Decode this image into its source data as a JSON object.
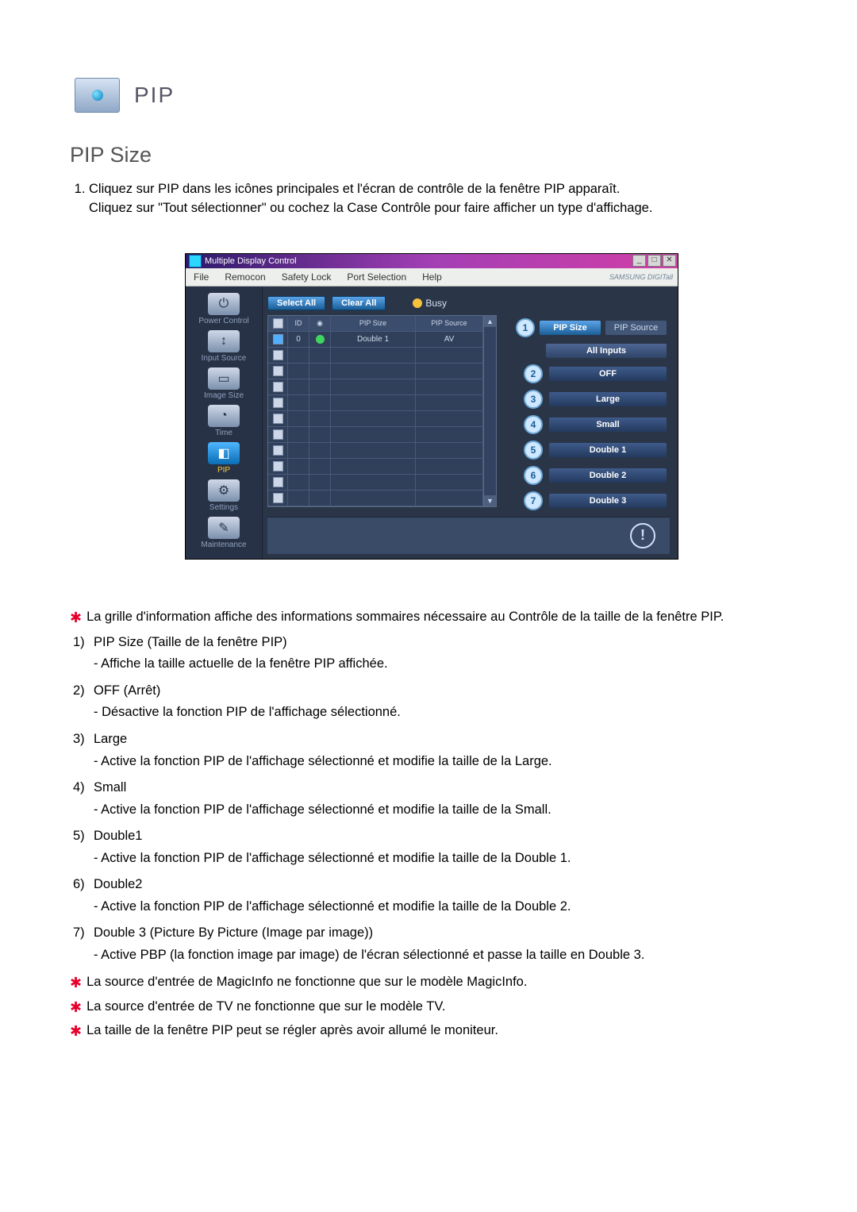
{
  "header": {
    "pip_label": "PIP",
    "pip_size_label": "PIP Size"
  },
  "intro": {
    "item1": "Cliquez sur PIP dans les icônes principales et l'écran de contrôle de la fenêtre PIP apparaît.",
    "item1b": "Cliquez sur \"Tout sélectionner\" ou cochez la Case Contrôle pour faire afficher un type d'affichage."
  },
  "shot": {
    "title": "Multiple Display Control",
    "menu": {
      "file": "File",
      "remocon": "Remocon",
      "safety": "Safety Lock",
      "port": "Port Selection",
      "help": "Help",
      "brand": "SAMSUNG DIGITall"
    },
    "buttons": {
      "select_all": "Select All",
      "clear_all": "Clear All",
      "busy": "Busy"
    },
    "sidebar": [
      {
        "label": "Power Control",
        "icon": "⏻"
      },
      {
        "label": "Input Source",
        "icon": "↕"
      },
      {
        "label": "Image Size",
        "icon": "▭"
      },
      {
        "label": "Time",
        "icon": "◔"
      },
      {
        "label": "PIP",
        "icon": "◧",
        "sel": true
      },
      {
        "label": "Settings",
        "icon": "⚙"
      },
      {
        "label": "Maintenance",
        "icon": "✎"
      }
    ],
    "grid": {
      "headers": {
        "chk": "☑",
        "id": "ID",
        "status": "",
        "size": "PIP Size",
        "source": "PIP Source"
      },
      "row": {
        "id": "0",
        "size": "Double 1",
        "source": "AV"
      }
    },
    "right": {
      "tab_size": "PIP Size",
      "tab_source": "PIP Source",
      "all_inputs": "All Inputs",
      "opts": [
        {
          "n": "2",
          "label": "OFF"
        },
        {
          "n": "3",
          "label": "Large"
        },
        {
          "n": "4",
          "label": "Small"
        },
        {
          "n": "5",
          "label": "Double 1"
        },
        {
          "n": "6",
          "label": "Double 2"
        },
        {
          "n": "7",
          "label": "Double 3"
        }
      ],
      "callout1": "1"
    }
  },
  "notes": {
    "star1": "La grille d'information affiche des informations sommaires nécessaire au Contrôle de la taille de la fenêtre PIP.",
    "items": [
      {
        "n": "1)",
        "t": "PIP Size (Taille de la fenêtre PIP)",
        "s": "- Affiche la taille actuelle de la fenêtre PIP affichée."
      },
      {
        "n": "2)",
        "t": "OFF (Arrêt)",
        "s": "- Désactive la fonction PIP de l'affichage sélectionné."
      },
      {
        "n": "3)",
        "t": "Large",
        "s": "- Active la fonction PIP de l'affichage sélectionné et modifie la taille de la Large."
      },
      {
        "n": "4)",
        "t": "Small",
        "s": "- Active la fonction PIP de l'affichage sélectionné et modifie la taille de la Small."
      },
      {
        "n": "5)",
        "t": "Double1",
        "s": "- Active la fonction PIP de l'affichage sélectionné et modifie la taille de la Double 1."
      },
      {
        "n": "6)",
        "t": "Double2",
        "s": "- Active la fonction PIP de l'affichage sélectionné et modifie la taille de la Double 2."
      },
      {
        "n": "7)",
        "t": "Double 3 (Picture By Picture (Image par image))",
        "s": "- Active PBP (la fonction image par image) de l'écran sélectionné et passe la taille en Double 3."
      }
    ],
    "star2": "La source d'entrée de MagicInfo ne fonctionne que sur le modèle MagicInfo.",
    "star3": "La source d'entrée de TV ne fonctionne que sur le modèle TV.",
    "star4": "La taille de la fenêtre PIP peut se régler après avoir allumé le moniteur."
  }
}
